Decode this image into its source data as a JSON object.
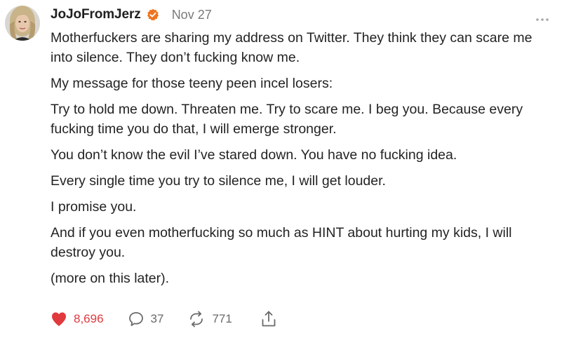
{
  "post": {
    "author": "JoJoFromJerz",
    "verified_icon": "verified-badge-icon",
    "date": "Nov 27",
    "more_icon": "more-options-icon",
    "paragraphs": [
      "Motherfuckers are sharing my address on Twitter. They think they can scare me into silence. They don’t fucking know me.",
      "My message for those teeny peen incel losers:",
      "Try to hold me down. Threaten me. Try to scare me. I beg you. Because every fucking time you do that, I will emerge stronger.",
      "You don’t know the evil I’ve stared down. You have no fucking idea.",
      "Every single time you try to silence me, I will get louder.",
      "I promise you.",
      "And if you even motherfucking so much as HINT about hurting my kids, I will destroy you.",
      "(more on this later)."
    ],
    "actions": {
      "likes": "8,696",
      "comments": "37",
      "restacks": "771"
    }
  },
  "colors": {
    "like_red": "#e0393e",
    "badge_orange": "#f0731f",
    "text": "#232323",
    "muted": "#7a7a7a"
  }
}
